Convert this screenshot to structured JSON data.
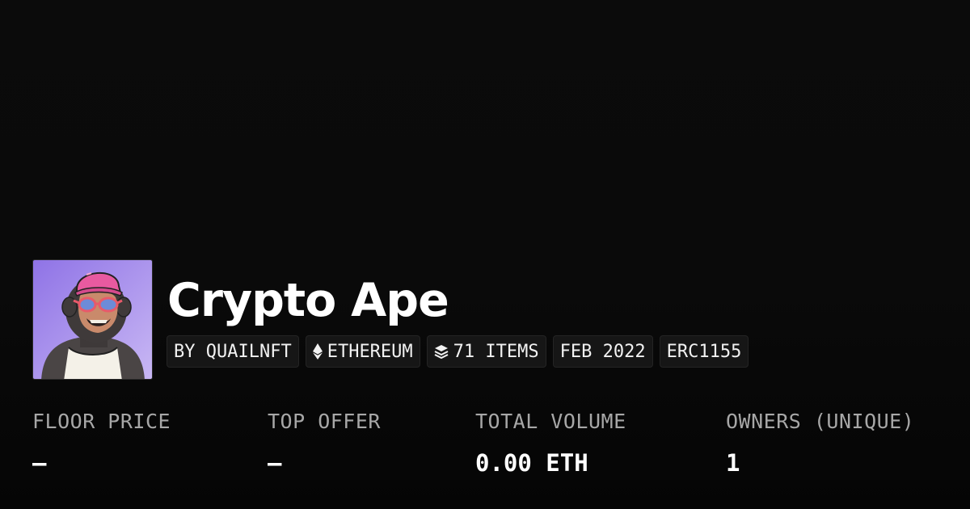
{
  "collection": {
    "name": "Crypto Ape",
    "avatar_icon": "ape-avatar"
  },
  "chips": [
    {
      "label": "BY QUAILNFT",
      "icon": null
    },
    {
      "label": "ETHEREUM",
      "icon": "ethereum-icon"
    },
    {
      "label": "71 ITEMS",
      "icon": "layers-icon"
    },
    {
      "label": "FEB 2022",
      "icon": null
    },
    {
      "label": "ERC1155",
      "icon": null
    }
  ],
  "stats": [
    {
      "label": "FLOOR PRICE",
      "value": "—"
    },
    {
      "label": "TOP OFFER",
      "value": "—"
    },
    {
      "label": "TOTAL VOLUME",
      "value": "0.00 ETH"
    },
    {
      "label": "OWNERS (UNIQUE)",
      "value": "1"
    }
  ],
  "colors": {
    "background": "#0a0a0a",
    "chip_background": "#161616",
    "label": "#a7a7a7",
    "avatar_background": "#9b84e8",
    "cap": "#e85aa0"
  }
}
